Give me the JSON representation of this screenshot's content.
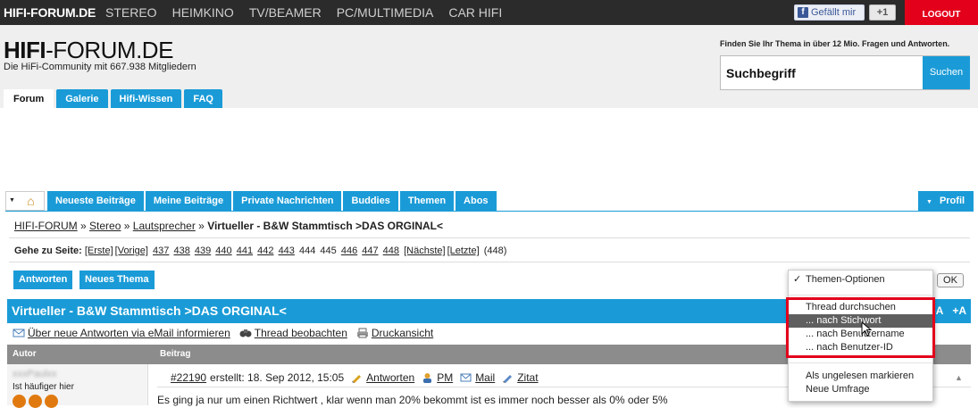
{
  "topbar": {
    "brand": "HIFI-FORUM.DE",
    "nav": [
      "STEREO",
      "HEIMKINO",
      "TV/BEAMER",
      "PC/MULTIMEDIA",
      "CAR HIFI"
    ],
    "fb_like": "Gefällt mir",
    "plus_one": "+1",
    "logout": "LOGOUT"
  },
  "header": {
    "logo_bold": "HIFI",
    "logo_rest": "-FORUM.DE",
    "tagline": "Die HiFi-Community mit 667.938 Mitgliedern",
    "search_hint": "Finden Sie Ihr Thema in über 12 Mio. Fragen und Antworten.",
    "search_value": "Suchbegriff",
    "search_button": "Suchen",
    "tabs": [
      "Forum",
      "Galerie",
      "Hifi-Wissen",
      "FAQ"
    ]
  },
  "nav2": {
    "items": [
      "Neueste Beiträge",
      "Meine Beiträge",
      "Private Nachrichten",
      "Buddies",
      "Themen",
      "Abos"
    ],
    "profil": "Profil"
  },
  "breadcrumb": {
    "items": [
      "HIFI-FORUM",
      "Stereo",
      "Lautsprecher"
    ],
    "sep": "»",
    "current": "Virtueller - B&W Stammtisch >DAS ORGINAL<"
  },
  "pager": {
    "label": "Gehe zu Seite:",
    "first": "[Erste]",
    "prev": "[Vorige]",
    "pages_before": [
      "437",
      "438",
      "439",
      "440",
      "441",
      "442",
      "443"
    ],
    "current_pages": [
      "444",
      "445"
    ],
    "pages_after": [
      "446",
      "447",
      "448"
    ],
    "next": "[Nächste]",
    "last": "[Letzte]",
    "total": "(448)"
  },
  "buttons": {
    "reply": "Antworten",
    "new_topic": "Neues Thema",
    "ok": "OK"
  },
  "thread": {
    "title": "Virtueller - B&W Stammtisch >DAS ORGINAL<",
    "size_small": "-A",
    "size_large": "+A",
    "action_email": "Über neue Antworten via eMail informieren",
    "action_watch": "Thread beobachten",
    "action_print": "Druckansicht"
  },
  "columns": {
    "author": "Autor",
    "post": "Beitrag"
  },
  "post": {
    "author_name": "xxxPaulxx",
    "author_rank": "Ist häufiger hier",
    "number": "#22190",
    "created": "erstellt: 18. Sep 2012, 15:05",
    "reply": "Antworten",
    "pm": "PM",
    "mail": "Mail",
    "quote": "Zitat",
    "text": "Es ging ja nur um einen Richtwert , klar wenn man 20% bekommt ist es immer noch besser als 0% oder 5%"
  },
  "menu": {
    "header": "Themen-Optionen",
    "check": "✓",
    "group1": [
      "Thread durchsuchen",
      "... nach Stichwort",
      "... nach Benutzername",
      "... nach Benutzer-ID"
    ],
    "highlighted_index": 1,
    "group2": [
      "Als ungelesen markieren",
      "Neue Umfrage"
    ]
  },
  "colors": {
    "accent": "#1a9bd7",
    "logout": "#e3001b",
    "topbar": "#2b2b2b",
    "highlight_frame": "#e3001b"
  }
}
